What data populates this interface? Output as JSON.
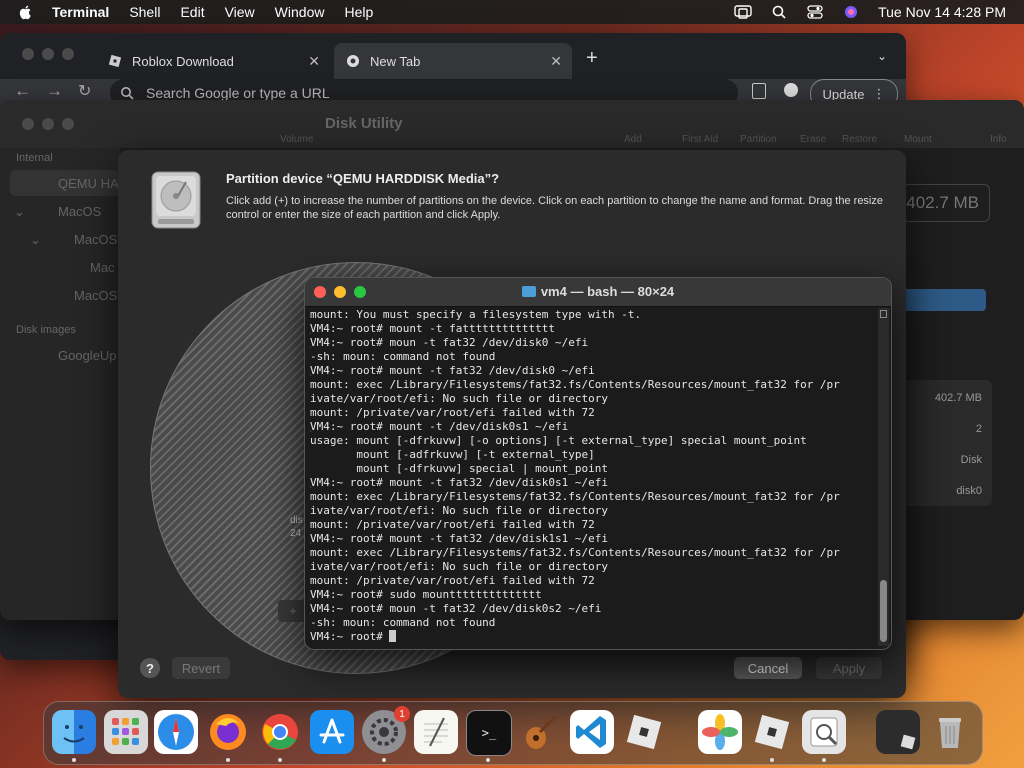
{
  "menubar": {
    "app_name": "Terminal",
    "items": [
      "Shell",
      "Edit",
      "View",
      "Window",
      "Help"
    ],
    "datetime": "Tue Nov 14  4:28 PM"
  },
  "browser": {
    "tabs": [
      {
        "label": "Roblox Download"
      },
      {
        "label": "New Tab"
      }
    ],
    "omnibox_placeholder": "Search Google or type a URL",
    "update_label": "Update"
  },
  "disk_utility": {
    "title": "Disk Utility",
    "sidebar": {
      "internal_header": "Internal",
      "items": [
        "QEMU HA",
        "MacOS",
        "MacOS",
        "Mac",
        "MacOS"
      ],
      "disk_images_header": "Disk images",
      "image_item": "GoogleUp"
    },
    "toolbar_labels": [
      "Volume",
      "Add",
      "First Aid",
      "Partition",
      "Erase",
      "Restore",
      "Mount",
      "Info"
    ],
    "capacity_display": "402.7 MB",
    "info_values": [
      "402.7 MB",
      "2",
      "Disk",
      "disk0"
    ]
  },
  "partition_sheet": {
    "title": "Partition device “QEMU HARDDISK Media”?",
    "description": "Click add (+) to increase the number of partitions on the device. Click on each partition to change the name and format. Drag the resize control or enter the size of each partition and click Apply.",
    "pie_label_line1": "dis",
    "pie_label_line2": "24",
    "revert_label": "Revert",
    "cancel_label": "Cancel",
    "apply_label": "Apply",
    "help_label": "?"
  },
  "terminal": {
    "title": "vm4 — bash — 80×24",
    "lines": [
      {
        "text": "mount: You must specify a filesystem type with -t.",
        "br": false
      },
      {
        "text": "VM4:~ root# mount -t fatttttttttttttt",
        "br": true
      },
      {
        "text": "VM4:~ root# moun -t fat32 /dev/disk0 ~/efi",
        "br": true
      },
      {
        "text": "-sh: moun: command not found",
        "br": false
      },
      {
        "text": "VM4:~ root# mount -t fat32 /dev/disk0 ~/efi",
        "br": true
      },
      {
        "text": "mount: exec /Library/Filesystems/fat32.fs/Contents/Resources/mount_fat32 for /pr",
        "br": false
      },
      {
        "text": "ivate/var/root/efi: No such file or directory",
        "br": false
      },
      {
        "text": "mount: /private/var/root/efi failed with 72",
        "br": false
      },
      {
        "text": "VM4:~ root# mount -t /dev/disk0s1 ~/efi",
        "br": true
      },
      {
        "text": "usage: mount [-dfrkuvw] [-o options] [-t external_type] special mount_point",
        "br": false
      },
      {
        "text": "       mount [-adfrkuvw] [-t external_type]",
        "br": false
      },
      {
        "text": "       mount [-dfrkuvw] special | mount_point",
        "br": false
      },
      {
        "text": "VM4:~ root# mount -t fat32 /dev/disk0s1 ~/efi",
        "br": true
      },
      {
        "text": "mount: exec /Library/Filesystems/fat32.fs/Contents/Resources/mount_fat32 for /pr",
        "br": false
      },
      {
        "text": "ivate/var/root/efi: No such file or directory",
        "br": false
      },
      {
        "text": "mount: /private/var/root/efi failed with 72",
        "br": false
      },
      {
        "text": "VM4:~ root# mount -t fat32 /dev/disk1s1 ~/efi",
        "br": true
      },
      {
        "text": "mount: exec /Library/Filesystems/fat32.fs/Contents/Resources/mount_fat32 for /pr",
        "br": false
      },
      {
        "text": "ivate/var/root/efi: No such file or directory",
        "br": false
      },
      {
        "text": "mount: /private/var/root/efi failed with 72",
        "br": false
      },
      {
        "text": "VM4:~ root# sudo mountttttttttttttt",
        "br": true
      },
      {
        "text": "VM4:~ root# moun -t fat32 /dev/disk0s2 ~/efi",
        "br": true
      },
      {
        "text": "-sh: moun: command not found",
        "br": false
      }
    ],
    "prompt": "VM4:~ root# "
  },
  "dock": {
    "apps": [
      "finder-icon",
      "launchpad-icon",
      "safari-icon",
      "firefox-icon",
      "chrome-icon",
      "app-store-icon",
      "system-settings-icon",
      "textedit-icon",
      "terminal-icon",
      "garageband-icon",
      "vscode-icon",
      "roblox-icon",
      "photos-icon",
      "roblox-icon",
      "preview-icon",
      "window-thumbnail-icon",
      "trash-icon"
    ],
    "settings_badge": "1"
  }
}
